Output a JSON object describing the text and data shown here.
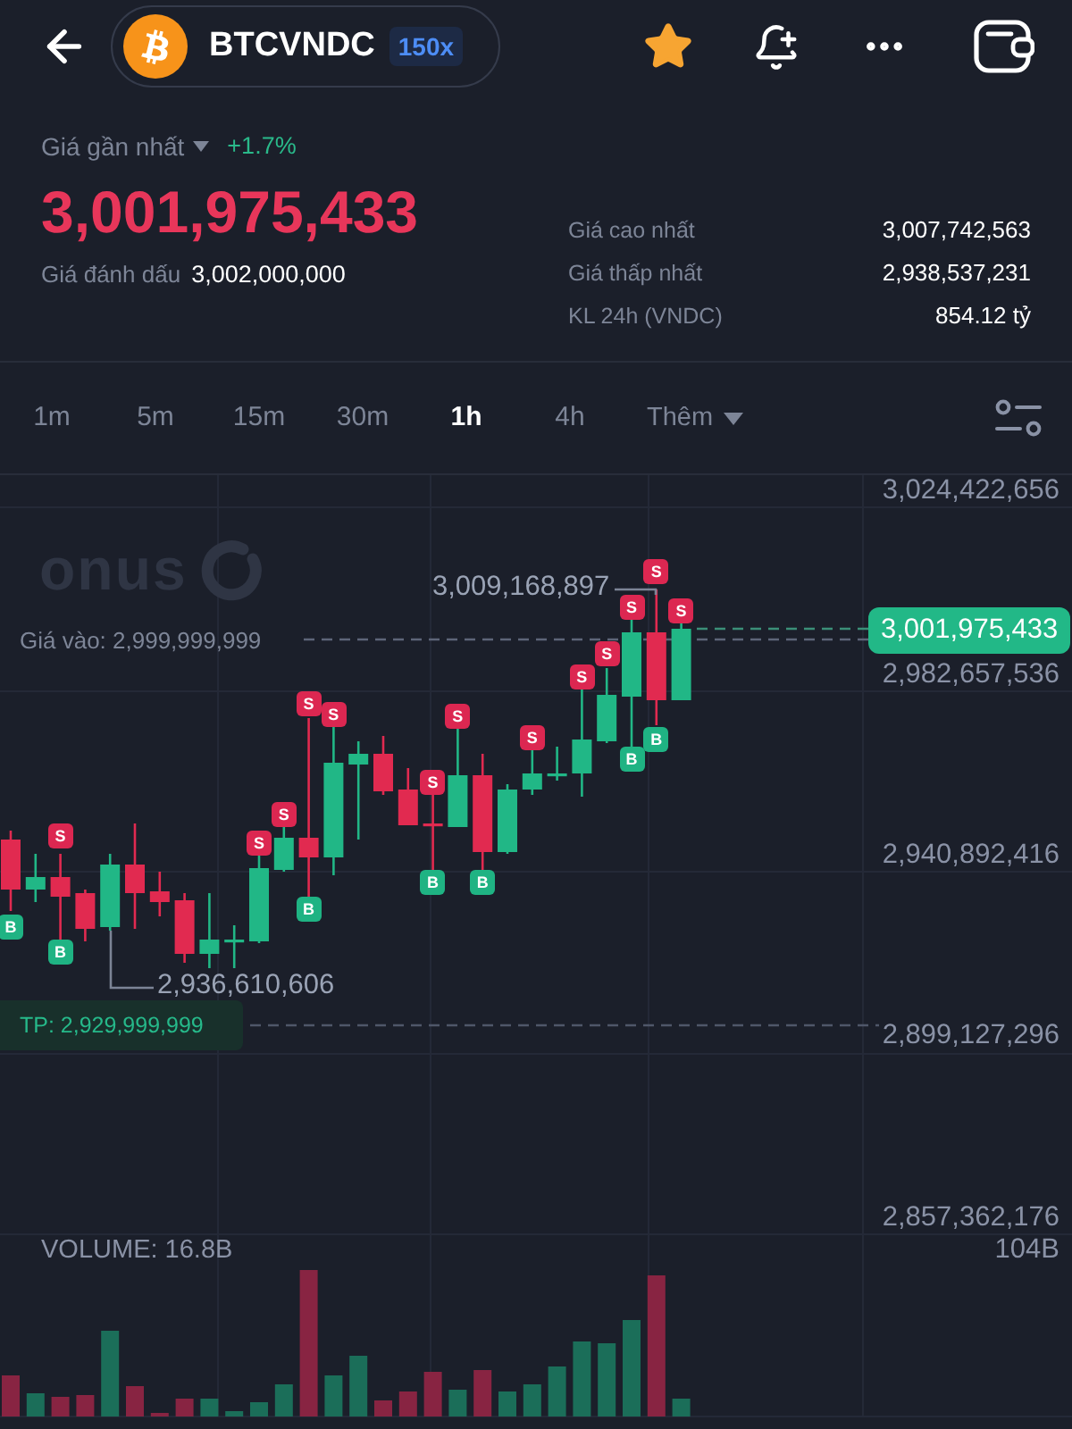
{
  "header": {
    "symbol": "BTCVNDC",
    "leverage": "150x",
    "favorite": true
  },
  "price": {
    "label": "Giá gần nhất",
    "change": "+1.7%",
    "last": "3,001,975,433",
    "mark_label": "Giá đánh dấu",
    "mark": "3,002,000,000"
  },
  "stats": [
    {
      "label": "Giá cao nhất",
      "value": "3,007,742,563"
    },
    {
      "label": "Giá thấp nhất",
      "value": "2,938,537,231"
    },
    {
      "label": "KL 24h (VNDC)",
      "value": "854.12 tỷ"
    }
  ],
  "timeframes": [
    {
      "label": "1m",
      "selected": false
    },
    {
      "label": "5m",
      "selected": false
    },
    {
      "label": "15m",
      "selected": false
    },
    {
      "label": "30m",
      "selected": false
    },
    {
      "label": "1h",
      "selected": true
    },
    {
      "label": "4h",
      "selected": false
    }
  ],
  "more_menu": {
    "label": "Thêm"
  },
  "chart": {
    "watermark": "onus",
    "price_axis": [
      "3,024,422,656",
      "2,982,657,536",
      "2,940,892,416",
      "2,899,127,296",
      "2,857,362,176"
    ],
    "current_price": "3,001,975,433",
    "entry_label": "Giá vào: 2,999,999,999",
    "take_profit": "TP: 2,929,999,999",
    "high_label": "3,009,168,897",
    "low_label": "2,936,610,606",
    "markers": [
      {
        "kind": "buy",
        "label": "B"
      },
      {
        "kind": "sell",
        "label": "S"
      },
      {
        "kind": "buy",
        "label": "B"
      },
      {
        "kind": "sell",
        "label": "S"
      },
      {
        "kind": "sell",
        "label": "S"
      },
      {
        "kind": "sell",
        "label": "S"
      },
      {
        "kind": "buy",
        "label": "B"
      },
      {
        "kind": "sell",
        "label": "S"
      },
      {
        "kind": "sell",
        "label": "S"
      },
      {
        "kind": "buy",
        "label": "B"
      },
      {
        "kind": "sell",
        "label": "S"
      },
      {
        "kind": "buy",
        "label": "B"
      },
      {
        "kind": "sell",
        "label": "S"
      },
      {
        "kind": "sell",
        "label": "S"
      },
      {
        "kind": "sell",
        "label": "S"
      },
      {
        "kind": "sell",
        "label": "S"
      },
      {
        "kind": "buy",
        "label": "B"
      },
      {
        "kind": "sell",
        "label": "S"
      },
      {
        "kind": "buy",
        "label": "B"
      },
      {
        "kind": "sell",
        "label": "S"
      }
    ]
  },
  "volume": {
    "label": "VOLUME: 16.8B",
    "scale_max": "104B"
  }
}
